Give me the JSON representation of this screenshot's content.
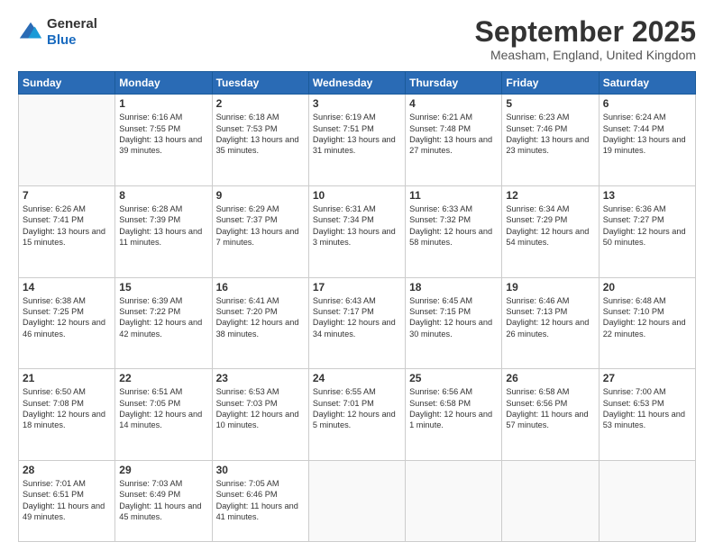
{
  "logo": {
    "line1": "General",
    "line2": "Blue"
  },
  "header": {
    "month": "September 2025",
    "location": "Measham, England, United Kingdom"
  },
  "weekdays": [
    "Sunday",
    "Monday",
    "Tuesday",
    "Wednesday",
    "Thursday",
    "Friday",
    "Saturday"
  ],
  "weeks": [
    [
      {
        "day": "",
        "sunrise": "",
        "sunset": "",
        "daylight": ""
      },
      {
        "day": "1",
        "sunrise": "Sunrise: 6:16 AM",
        "sunset": "Sunset: 7:55 PM",
        "daylight": "Daylight: 13 hours and 39 minutes."
      },
      {
        "day": "2",
        "sunrise": "Sunrise: 6:18 AM",
        "sunset": "Sunset: 7:53 PM",
        "daylight": "Daylight: 13 hours and 35 minutes."
      },
      {
        "day": "3",
        "sunrise": "Sunrise: 6:19 AM",
        "sunset": "Sunset: 7:51 PM",
        "daylight": "Daylight: 13 hours and 31 minutes."
      },
      {
        "day": "4",
        "sunrise": "Sunrise: 6:21 AM",
        "sunset": "Sunset: 7:48 PM",
        "daylight": "Daylight: 13 hours and 27 minutes."
      },
      {
        "day": "5",
        "sunrise": "Sunrise: 6:23 AM",
        "sunset": "Sunset: 7:46 PM",
        "daylight": "Daylight: 13 hours and 23 minutes."
      },
      {
        "day": "6",
        "sunrise": "Sunrise: 6:24 AM",
        "sunset": "Sunset: 7:44 PM",
        "daylight": "Daylight: 13 hours and 19 minutes."
      }
    ],
    [
      {
        "day": "7",
        "sunrise": "Sunrise: 6:26 AM",
        "sunset": "Sunset: 7:41 PM",
        "daylight": "Daylight: 13 hours and 15 minutes."
      },
      {
        "day": "8",
        "sunrise": "Sunrise: 6:28 AM",
        "sunset": "Sunset: 7:39 PM",
        "daylight": "Daylight: 13 hours and 11 minutes."
      },
      {
        "day": "9",
        "sunrise": "Sunrise: 6:29 AM",
        "sunset": "Sunset: 7:37 PM",
        "daylight": "Daylight: 13 hours and 7 minutes."
      },
      {
        "day": "10",
        "sunrise": "Sunrise: 6:31 AM",
        "sunset": "Sunset: 7:34 PM",
        "daylight": "Daylight: 13 hours and 3 minutes."
      },
      {
        "day": "11",
        "sunrise": "Sunrise: 6:33 AM",
        "sunset": "Sunset: 7:32 PM",
        "daylight": "Daylight: 12 hours and 58 minutes."
      },
      {
        "day": "12",
        "sunrise": "Sunrise: 6:34 AM",
        "sunset": "Sunset: 7:29 PM",
        "daylight": "Daylight: 12 hours and 54 minutes."
      },
      {
        "day": "13",
        "sunrise": "Sunrise: 6:36 AM",
        "sunset": "Sunset: 7:27 PM",
        "daylight": "Daylight: 12 hours and 50 minutes."
      }
    ],
    [
      {
        "day": "14",
        "sunrise": "Sunrise: 6:38 AM",
        "sunset": "Sunset: 7:25 PM",
        "daylight": "Daylight: 12 hours and 46 minutes."
      },
      {
        "day": "15",
        "sunrise": "Sunrise: 6:39 AM",
        "sunset": "Sunset: 7:22 PM",
        "daylight": "Daylight: 12 hours and 42 minutes."
      },
      {
        "day": "16",
        "sunrise": "Sunrise: 6:41 AM",
        "sunset": "Sunset: 7:20 PM",
        "daylight": "Daylight: 12 hours and 38 minutes."
      },
      {
        "day": "17",
        "sunrise": "Sunrise: 6:43 AM",
        "sunset": "Sunset: 7:17 PM",
        "daylight": "Daylight: 12 hours and 34 minutes."
      },
      {
        "day": "18",
        "sunrise": "Sunrise: 6:45 AM",
        "sunset": "Sunset: 7:15 PM",
        "daylight": "Daylight: 12 hours and 30 minutes."
      },
      {
        "day": "19",
        "sunrise": "Sunrise: 6:46 AM",
        "sunset": "Sunset: 7:13 PM",
        "daylight": "Daylight: 12 hours and 26 minutes."
      },
      {
        "day": "20",
        "sunrise": "Sunrise: 6:48 AM",
        "sunset": "Sunset: 7:10 PM",
        "daylight": "Daylight: 12 hours and 22 minutes."
      }
    ],
    [
      {
        "day": "21",
        "sunrise": "Sunrise: 6:50 AM",
        "sunset": "Sunset: 7:08 PM",
        "daylight": "Daylight: 12 hours and 18 minutes."
      },
      {
        "day": "22",
        "sunrise": "Sunrise: 6:51 AM",
        "sunset": "Sunset: 7:05 PM",
        "daylight": "Daylight: 12 hours and 14 minutes."
      },
      {
        "day": "23",
        "sunrise": "Sunrise: 6:53 AM",
        "sunset": "Sunset: 7:03 PM",
        "daylight": "Daylight: 12 hours and 10 minutes."
      },
      {
        "day": "24",
        "sunrise": "Sunrise: 6:55 AM",
        "sunset": "Sunset: 7:01 PM",
        "daylight": "Daylight: 12 hours and 5 minutes."
      },
      {
        "day": "25",
        "sunrise": "Sunrise: 6:56 AM",
        "sunset": "Sunset: 6:58 PM",
        "daylight": "Daylight: 12 hours and 1 minute."
      },
      {
        "day": "26",
        "sunrise": "Sunrise: 6:58 AM",
        "sunset": "Sunset: 6:56 PM",
        "daylight": "Daylight: 11 hours and 57 minutes."
      },
      {
        "day": "27",
        "sunrise": "Sunrise: 7:00 AM",
        "sunset": "Sunset: 6:53 PM",
        "daylight": "Daylight: 11 hours and 53 minutes."
      }
    ],
    [
      {
        "day": "28",
        "sunrise": "Sunrise: 7:01 AM",
        "sunset": "Sunset: 6:51 PM",
        "daylight": "Daylight: 11 hours and 49 minutes."
      },
      {
        "day": "29",
        "sunrise": "Sunrise: 7:03 AM",
        "sunset": "Sunset: 6:49 PM",
        "daylight": "Daylight: 11 hours and 45 minutes."
      },
      {
        "day": "30",
        "sunrise": "Sunrise: 7:05 AM",
        "sunset": "Sunset: 6:46 PM",
        "daylight": "Daylight: 11 hours and 41 minutes."
      },
      {
        "day": "",
        "sunrise": "",
        "sunset": "",
        "daylight": ""
      },
      {
        "day": "",
        "sunrise": "",
        "sunset": "",
        "daylight": ""
      },
      {
        "day": "",
        "sunrise": "",
        "sunset": "",
        "daylight": ""
      },
      {
        "day": "",
        "sunrise": "",
        "sunset": "",
        "daylight": ""
      }
    ]
  ]
}
